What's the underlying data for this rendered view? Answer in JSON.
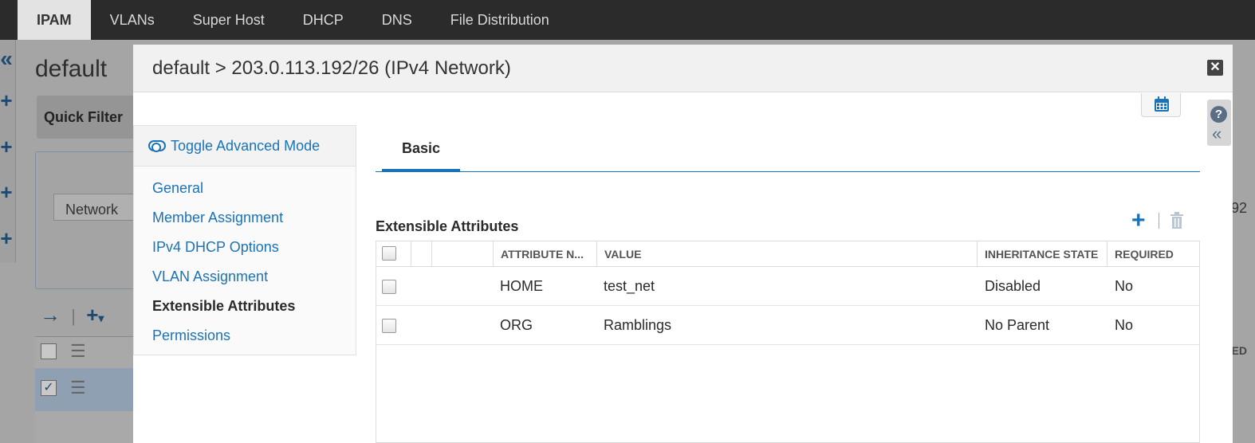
{
  "topnav": {
    "tabs": [
      {
        "label": "IPAM",
        "active": true
      },
      {
        "label": "VLANs"
      },
      {
        "label": "Super Host"
      },
      {
        "label": "DHCP"
      },
      {
        "label": "DNS"
      },
      {
        "label": "File Distribution"
      }
    ]
  },
  "background": {
    "title": "default",
    "quick_filter_label": "Quick Filter",
    "network_field": "Network",
    "right_fragment": "92",
    "right_header_fragment": "ED"
  },
  "modal": {
    "title": "default > 203.0.113.192/26 (IPv4 Network)",
    "close_icon": "close-icon",
    "toggle_advanced": "Toggle Advanced Mode",
    "nav": [
      {
        "label": "General"
      },
      {
        "label": "Member Assignment"
      },
      {
        "label": "IPv4 DHCP Options"
      },
      {
        "label": "VLAN Assignment"
      },
      {
        "label": "Extensible Attributes",
        "active": true
      },
      {
        "label": "Permissions"
      }
    ],
    "tabs": [
      {
        "label": "Basic",
        "active": true
      }
    ],
    "section_title": "Extensible Attributes",
    "grid": {
      "columns": [
        "ATTRIBUTE N...",
        "VALUE",
        "INHERITANCE STATE",
        "REQUIRED"
      ],
      "rows": [
        {
          "attribute": "HOME",
          "value": "test_net",
          "inheritance": "Disabled",
          "required": "No"
        },
        {
          "attribute": "ORG",
          "value": "Ramblings",
          "inheritance": "No Parent",
          "required": "No"
        }
      ]
    }
  },
  "colors": {
    "accent": "#1a73b8",
    "topnav_bg": "#2b2b2b",
    "overlay_bg": "#a5a5a5"
  }
}
